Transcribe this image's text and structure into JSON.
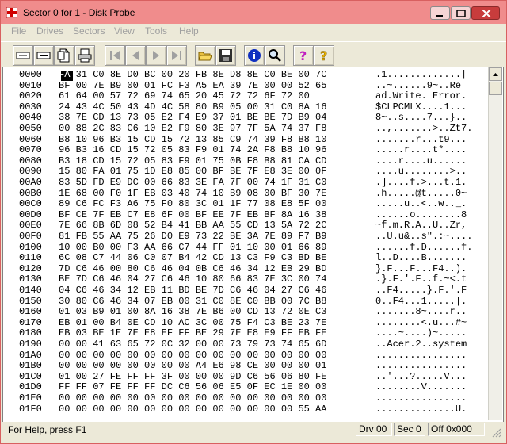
{
  "window": {
    "title": "Sector 0 for 1 - Disk Probe",
    "app_icon": "red-cross-icon",
    "title_color": "#f08c8c"
  },
  "menu": [
    "File",
    "Drives",
    "Sectors",
    "View",
    "Tools",
    "Help"
  ],
  "toolbar": {
    "buttons": [
      "text-view-icon",
      "byte-view-icon",
      "document-icon",
      "print-icon",
      "first-record-icon",
      "previous-record-icon",
      "next-record-icon",
      "last-record-icon",
      "open-folder-icon",
      "save-icon",
      "info-icon",
      "search-icon",
      "help-icon",
      "context-help-icon"
    ]
  },
  "hex_view": {
    "selected_byte": "FA",
    "rows": [
      {
        "off": "0000",
        "hex": "FA 31 C0 8E D0 BC 00 20 FB 8E D8 8E C0 BE 00 7C",
        "ascii": ".1.............|"
      },
      {
        "off": "0010",
        "hex": "BF 00 7E B9 00 01 FC F3 A5 EA 39 7E 00 00 52 65",
        "ascii": "..~......9~..Re"
      },
      {
        "off": "0020",
        "hex": "61 64 00 57 72 69 74 65 20 45 72 72 6F 72 00",
        "ascii": "ad.Write. Error."
      },
      {
        "off": "0030",
        "hex": "24 43 4C 50 43 4D 4C 58 80 B9 05 00 31 C0 8A 16",
        "ascii": "$CLPCMLX....1..."
      },
      {
        "off": "0040",
        "hex": "38 7E CD 13 73 05 E2 F4 E9 37 01 BE BE 7D B9 04",
        "ascii": "8~..s....7...}.."
      },
      {
        "off": "0050",
        "hex": "00 88 2C 83 C6 10 E2 F9 80 3E 97 7F 5A 74 37 F8",
        "ascii": "..,.......>..Zt7."
      },
      {
        "off": "0060",
        "hex": "B8 10 96 B3 15 CD 15 72 13 85 C9 74 39 F8 B8 10",
        "ascii": ".......r...t9..."
      },
      {
        "off": "0070",
        "hex": "96 B3 16 CD 15 72 05 83 F9 01 74 2A F8 B8 10 96",
        "ascii": ".....r....t*...."
      },
      {
        "off": "0080",
        "hex": "B3 18 CD 15 72 05 83 F9 01 75 0B F8 B8 81 CA CD",
        "ascii": "....r....u......"
      },
      {
        "off": "0090",
        "hex": "15 80 FA 01 75 1D E8 85 00 BF BE 7F E8 3E 00 0F",
        "ascii": "....u........>.."
      },
      {
        "off": "00A0",
        "hex": "83 5D FD E9 DC 00 66 83 3E FA 7F 00 74 1F 31 C0",
        "ascii": ".]....f.>...t.1."
      },
      {
        "off": "00B0",
        "hex": "1E 68 00 F0 1F EB 03 40 74 10 B9 08 00 BF 30 7E",
        "ascii": ".h.....@t.....0~"
      },
      {
        "off": "00C0",
        "hex": "89 C6 FC F3 A6 75 F0 80 3C 01 1F 77 08 E8 5F 00",
        "ascii": ".....u..<..w.._."
      },
      {
        "off": "00D0",
        "hex": "BF CE 7F EB C7 E8 6F 00 BF EE 7F EB BF 8A 16 38",
        "ascii": "......o........8"
      },
      {
        "off": "00E0",
        "hex": "7E 66 8B 6D 08 52 B4 41 BB AA 55 CD 13 5A 72 2C",
        "ascii": "~f.m.R.A..U..Zr,"
      },
      {
        "off": "00F0",
        "hex": "81 FB 55 AA 75 26 D0 E9 73 22 BE 3A 7E 89 F7 B9",
        "ascii": "..U.u&..s\".:~...."
      },
      {
        "off": "0100",
        "hex": "10 00 B0 00 F3 AA 66 C7 44 FF 01 10 00 01 66 89",
        "ascii": "......f.D......f."
      },
      {
        "off": "0110",
        "hex": "6C 08 C7 44 06 C0 07 B4 42 CD 13 C3 F9 C3 BD BE",
        "ascii": "l..D....B......."
      },
      {
        "off": "0120",
        "hex": "7D C6 46 00 80 C6 46 04 0B C6 46 34 12 EB 29 BD",
        "ascii": "}.F...F...F4..)."
      },
      {
        "off": "0130",
        "hex": "BE 7D C6 46 04 27 C6 46 10 80 66 83 7E 3C 00 74",
        "ascii": ".}.F.'.F..f.~<.t"
      },
      {
        "off": "0140",
        "hex": "04 C6 46 34 12 EB 11 BD BE 7D C6 46 04 27 C6 46",
        "ascii": "..F4.....}.F.'.F"
      },
      {
        "off": "0150",
        "hex": "30 80 C6 46 34 07 EB 00 31 C0 8E C0 BB 00 7C B8",
        "ascii": "0..F4...1.....|."
      },
      {
        "off": "0160",
        "hex": "01 03 B9 01 00 8A 16 38 7E B6 00 CD 13 72 0E C3",
        "ascii": ".......8~....r.."
      },
      {
        "off": "0170",
        "hex": "EB 01 00 B4 0E CD 10 AC 3C 00 75 F4 C3 BE 23 7E",
        "ascii": "........<.u...#~"
      },
      {
        "off": "0180",
        "hex": "EB 03 BE 1E 7E E8 EF FF BE 29 7E E8 E9 FF EB FE",
        "ascii": "....~....)~....."
      },
      {
        "off": "0190",
        "hex": "00 00 41 63 65 72 0C 32 00 00 73 79 73 74 65 6D",
        "ascii": "..Acer.2..system"
      },
      {
        "off": "01A0",
        "hex": "00 00 00 00 00 00 00 00 00 00 00 00 00 00 00 00",
        "ascii": "................"
      },
      {
        "off": "01B0",
        "hex": "00 00 00 00 00 00 00 00 A4 E6 98 CE 00 00 00 01",
        "ascii": "................"
      },
      {
        "off": "01C0",
        "hex": "01 00 27 FE FF FF 3F 00 00 00 9D C6 56 06 80 FE",
        "ascii": "..'...?.....V..."
      },
      {
        "off": "01D0",
        "hex": "FF FF 07 FE FF FF DC C6 56 06 E5 0F EC 1E 00 00",
        "ascii": "........V......."
      },
      {
        "off": "01E0",
        "hex": "00 00 00 00 00 00 00 00 00 00 00 00 00 00 00 00",
        "ascii": "................"
      },
      {
        "off": "01F0",
        "hex": "00 00 00 00 00 00 00 00 00 00 00 00 00 00 55 AA",
        "ascii": "..............U."
      }
    ]
  },
  "status": {
    "help_text": "For Help, press F1",
    "drive": "Drv 00",
    "sector": "Sec 0",
    "offset": "Off 0x000"
  }
}
